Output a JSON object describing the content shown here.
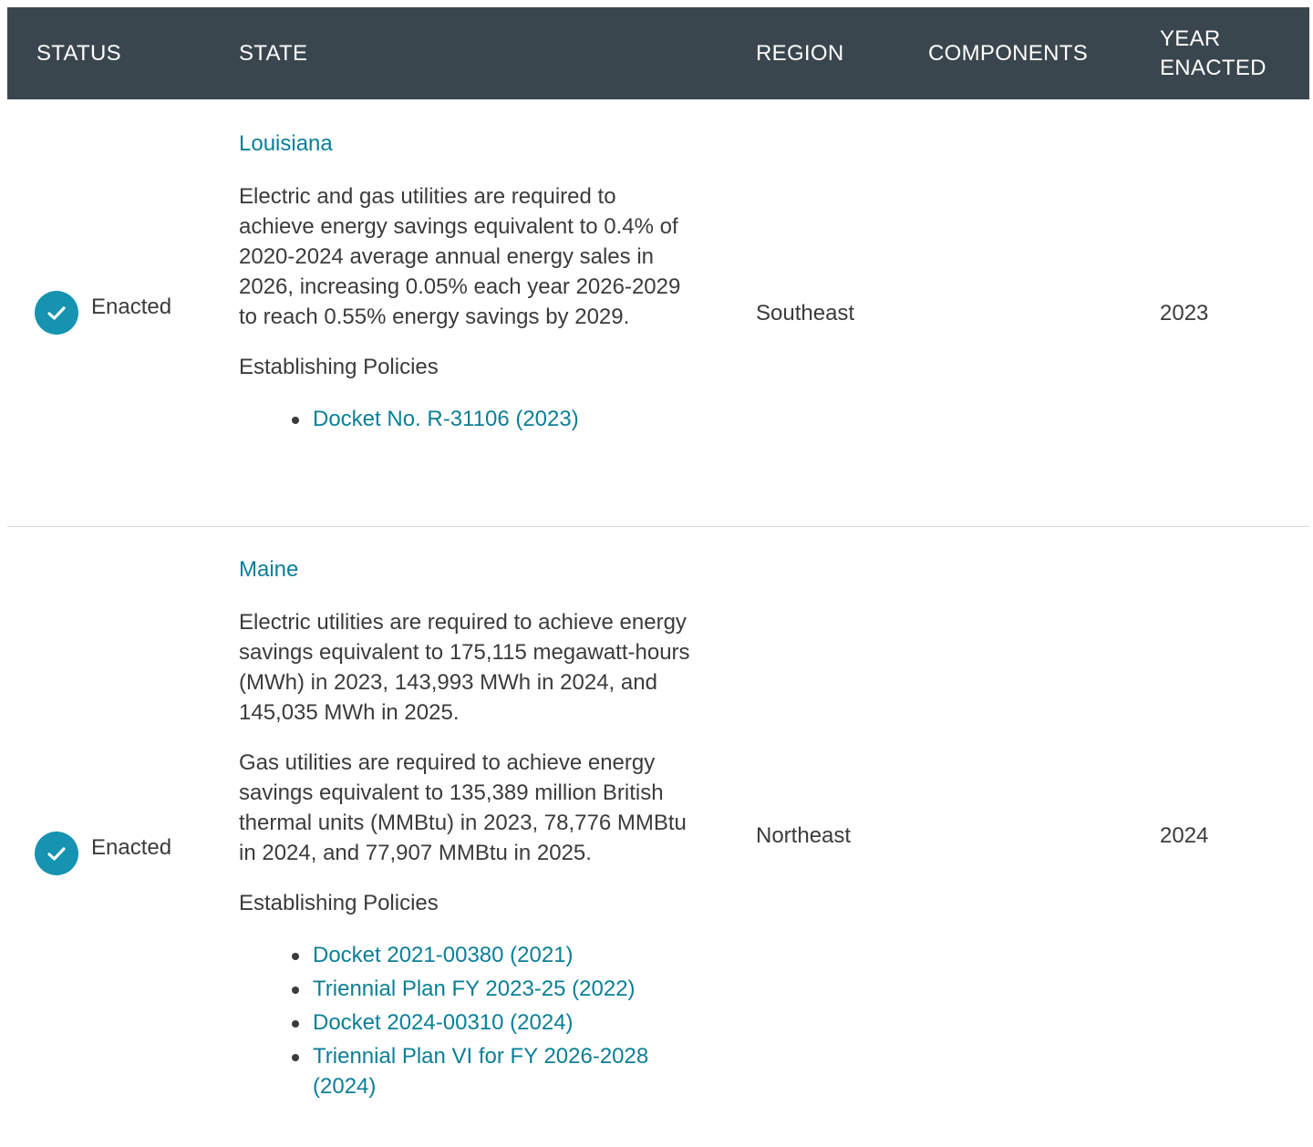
{
  "header": {
    "status": "STATUS",
    "state": "STATE",
    "region": "REGION",
    "components": "COMPONENTS",
    "year_enacted": "YEAR ENACTED"
  },
  "colors": {
    "header_bg": "#3a464e",
    "link": "#0b7f96",
    "badge": "#1593b0"
  },
  "rows": [
    {
      "status": "Enacted",
      "status_icon": "check-circle-icon",
      "state": "Louisiana",
      "descriptions": [
        "Electric and gas utilities are required to achieve energy savings equivalent to 0.4% of 2020-2024 average annual energy sales in 2026, increasing 0.05% each year 2026-2029 to reach 0.55% energy savings by 2029."
      ],
      "policies_heading": "Establishing Policies",
      "policies": [
        "Docket No. R-31106 (2023)"
      ],
      "region": "Southeast",
      "components": "",
      "year": "2023"
    },
    {
      "status": "Enacted",
      "status_icon": "check-circle-icon",
      "state": "Maine",
      "descriptions": [
        "Electric utilities are required to achieve energy savings equivalent to 175,115 megawatt-hours (MWh) in 2023, 143,993 MWh in 2024, and 145,035 MWh in 2025.",
        "Gas utilities are required to achieve energy savings equivalent to 135,389 million British thermal units (MMBtu) in 2023, 78,776 MMBtu in 2024, and 77,907 MMBtu in 2025."
      ],
      "policies_heading": "Establishing Policies",
      "policies": [
        "Docket 2021-00380 (2021)",
        "Triennial Plan FY 2023-25 (2022)",
        "Docket 2024-00310 (2024)",
        "Triennial Plan VI for FY 2026-2028 (2024)"
      ],
      "region": "Northeast",
      "components": "",
      "year": "2024"
    }
  ]
}
